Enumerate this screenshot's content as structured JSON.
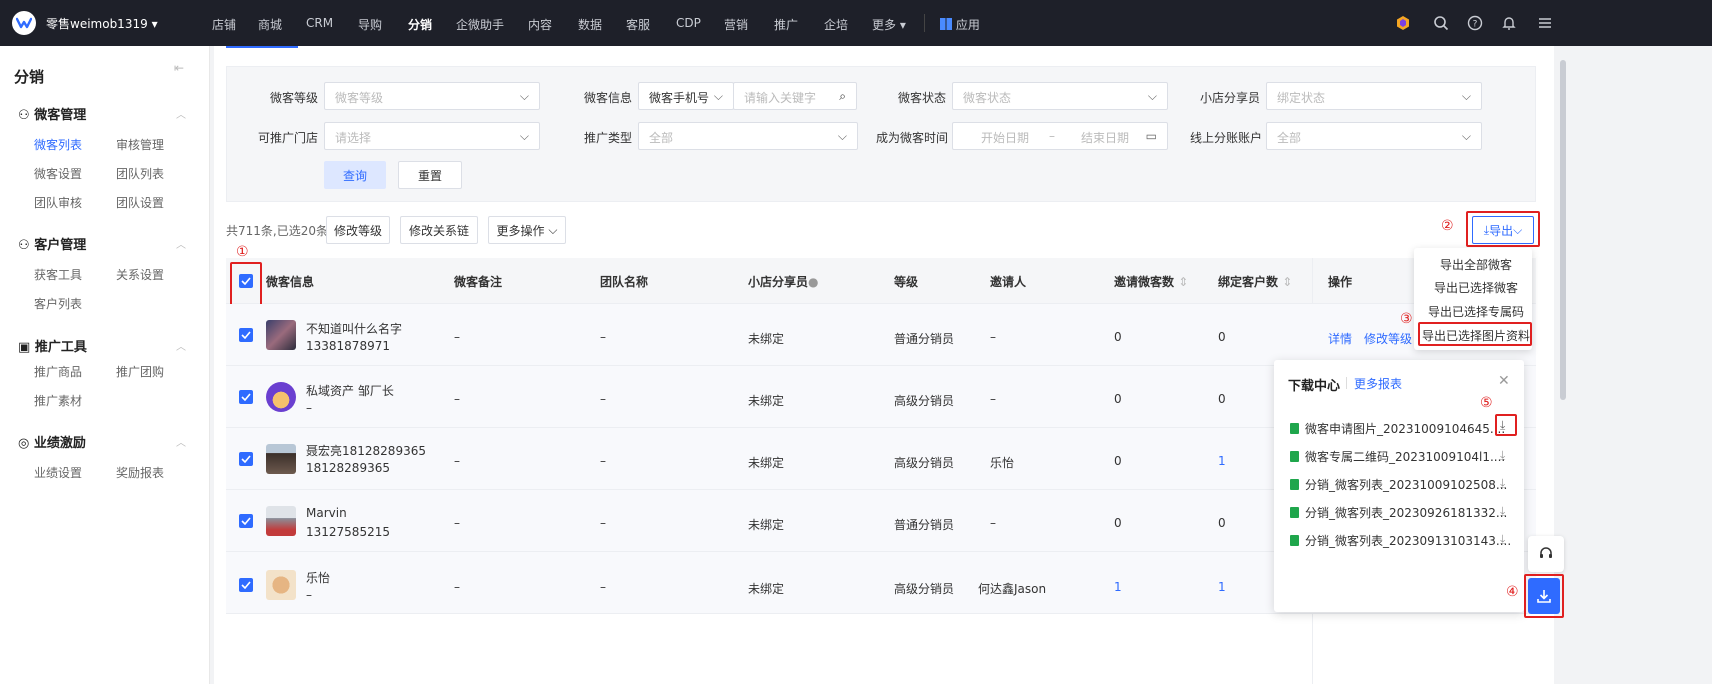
{
  "topbar": {
    "brand": "零售weimob1319",
    "nav": [
      "店铺",
      "商城",
      "CRM",
      "导购",
      "分销",
      "企微助手",
      "内容",
      "数据",
      "客服",
      "CDP",
      "营销",
      "推广",
      "企培",
      "更多"
    ],
    "active_nav": "分销",
    "apps_label": "应用"
  },
  "sidebar": {
    "title": "分销",
    "groups": [
      {
        "label": "微客管理",
        "items": [
          "微客列表",
          "审核管理",
          "微客设置",
          "团队列表",
          "团队审核",
          "团队设置"
        ]
      },
      {
        "label": "客户管理",
        "items": [
          "获客工具",
          "关系设置",
          "客户列表"
        ]
      },
      {
        "label": "推广工具",
        "items": [
          "推广商品",
          "推广团购",
          "推广素材"
        ]
      },
      {
        "label": "业绩激励",
        "items": [
          "业绩设置",
          "奖励报表"
        ]
      }
    ]
  },
  "filters": {
    "level_label": "微客等级",
    "level_placeholder": "微客等级",
    "info_label": "微客信息",
    "info_type": "微客手机号",
    "info_placeholder": "请输入关键字",
    "status_label": "微客状态",
    "status_placeholder": "微客状态",
    "sharer_label": "小店分享员",
    "sharer_placeholder": "绑定状态",
    "store_label": "可推广门店",
    "store_placeholder": "请选择",
    "promo_label": "推广类型",
    "promo_value": "全部",
    "time_label": "成为微客时间",
    "start_placeholder": "开始日期",
    "sep": "–",
    "end_placeholder": "结束日期",
    "account_label": "线上分账账户",
    "account_value": "全部",
    "query": "查询",
    "reset": "重置"
  },
  "toolbar": {
    "count": "共711条,已选20条",
    "modify_level": "修改等级",
    "modify_chain": "修改关系链",
    "more": "更多操作",
    "export": "导出"
  },
  "columns": [
    "微客信息",
    "微客备注",
    "团队名称",
    "小店分享员",
    "等级",
    "邀请人",
    "邀请微客数",
    "绑定客户数",
    "操作"
  ],
  "rows": [
    {
      "name": "不知道叫什么名字",
      "phone": "13381878971",
      "remark": "–",
      "team": "–",
      "sharer": "未绑定",
      "level": "普通分销员",
      "inviter": "–",
      "invites": "0",
      "bound": "0",
      "invites_link": false,
      "bound_link": false
    },
    {
      "name": "私域资产 邹厂长",
      "phone": "–",
      "remark": "–",
      "team": "–",
      "sharer": "未绑定",
      "level": "高级分销员",
      "inviter": "–",
      "invites": "0",
      "bound": "0",
      "invites_link": false,
      "bound_link": false
    },
    {
      "name": "聂宏亮18128289365",
      "phone": "18128289365",
      "remark": "–",
      "team": "–",
      "sharer": "未绑定",
      "level": "高级分销员",
      "inviter": "乐怡",
      "invites": "0",
      "bound": "1",
      "invites_link": false,
      "bound_link": true
    },
    {
      "name": "Marvin",
      "phone": "13127585215",
      "remark": "–",
      "team": "–",
      "sharer": "未绑定",
      "level": "普通分销员",
      "inviter": "–",
      "invites": "0",
      "bound": "0",
      "invites_link": false,
      "bound_link": false
    },
    {
      "name": "乐怡",
      "phone": "–",
      "remark": "–",
      "team": "–",
      "sharer": "未绑定",
      "level": "高级分销员",
      "inviter": "何达鑫Jason",
      "invites": "1",
      "bound": "1",
      "invites_link": true,
      "bound_link": true
    }
  ],
  "row_actions": {
    "detail": "详情",
    "modify": "修改等级"
  },
  "export_menu": [
    "导出全部微客",
    "导出已选择微客",
    "导出已选择专属码",
    "导出已选择图片资料"
  ],
  "download_center": {
    "title": "下载中心",
    "more": "更多报表",
    "files": [
      "微客申请图片_20231009104645....",
      "微客专属二维码_20231009104l1....",
      "分销_微客列表_20231009102508...",
      "分销_微客列表_20230926181332...",
      "分销_微客列表_20230913103143...."
    ]
  },
  "annotations": [
    "①",
    "②",
    "③",
    "④",
    "⑤"
  ],
  "colors": {
    "accent": "#2f6bff",
    "annotation": "#e02020",
    "topbar": "#1e2029"
  }
}
